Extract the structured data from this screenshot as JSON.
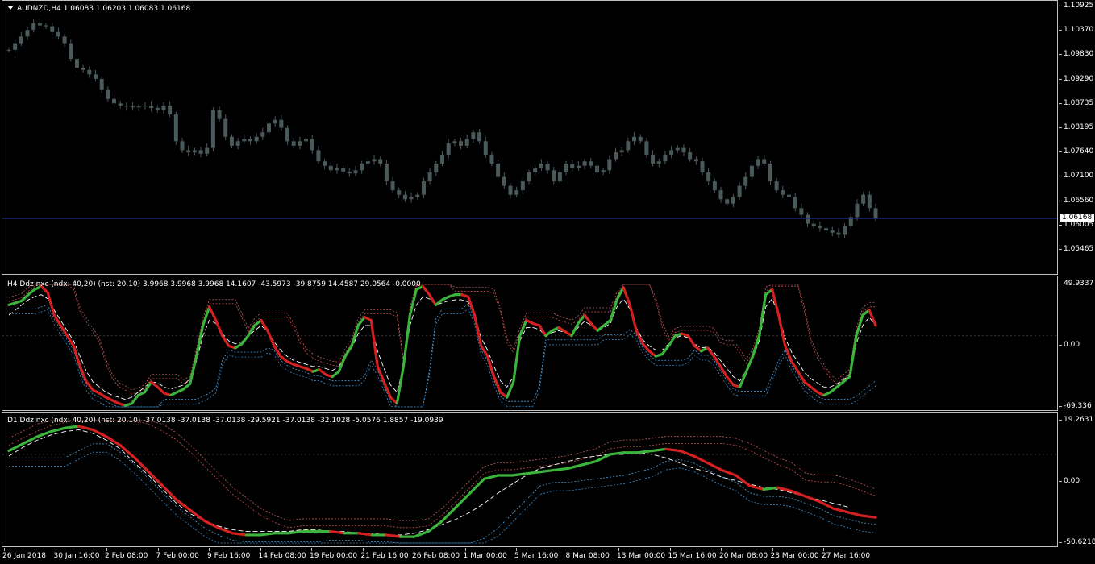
{
  "main": {
    "symbol": "AUDNZD,H4",
    "ohlc": "1.06083 1.06203 1.06083 1.06168",
    "title": "AUDNZD,H4  1.06083 1.06203 1.06083 1.06168",
    "price_levels": [
      "1.10925",
      "1.10370",
      "1.09830",
      "1.09290",
      "1.08735",
      "1.08195",
      "1.07640",
      "1.07100",
      "1.06560",
      "1.06005",
      "1.05465"
    ],
    "current_price": "1.06168",
    "colors": {
      "candles": "#4a5a5a",
      "price_line": "#1e2a9a",
      "background": "#000000"
    }
  },
  "h4": {
    "title": "H4 Ddz nxc (ndx: 40,20) (nst: 20,10) 3.9968 3.9968 3.9968 14.1607 -43.5973 -39.8759 14.4587 29.0564 -0.0000",
    "levels": [
      "49.9337",
      "0.00",
      "-69.336"
    ]
  },
  "d1": {
    "title": "D1 Ddz nxc (ndx: 40,20) (nst: 20,10) -37.0138 -37.0138 -37.0138 -29.5921 -37.0138 -32.1028 -5.0576 1.8857 -19.0939",
    "levels": [
      "19.2631",
      "0.00",
      "-50.6218"
    ]
  },
  "xaxis": [
    "26 Jan 2018",
    "30 Jan 16:00",
    "2 Feb 08:00",
    "7 Feb 00:00",
    "9 Feb 16:00",
    "14 Feb 08:00",
    "19 Feb 00:00",
    "21 Feb 16:00",
    "26 Feb 08:00",
    "1 Mar 00:00",
    "5 Mar 16:00",
    "8 Mar 08:00",
    "13 Mar 00:00",
    "15 Mar 16:00",
    "20 Mar 08:00",
    "23 Mar 00:00",
    "27 Mar 16:00"
  ],
  "chart_data": [
    {
      "type": "candlestick",
      "title": "AUDNZD,H4",
      "ylim": [
        1.05465,
        1.10925
      ],
      "close_approx": [
        1.0995,
        1.101,
        1.1025,
        1.104,
        1.1055,
        1.105,
        1.1048,
        1.1035,
        1.1025,
        1.101,
        1.0975,
        1.0955,
        1.095,
        1.094,
        1.093,
        1.0905,
        1.0885,
        1.0875,
        1.087,
        1.0868,
        1.0866,
        1.0868,
        1.087,
        1.0865,
        1.086,
        1.087,
        1.085,
        1.079,
        1.077,
        1.0765,
        1.077,
        1.0762,
        1.0775,
        1.086,
        1.084,
        1.08,
        1.078,
        1.079,
        1.0795,
        1.079,
        1.08,
        1.081,
        1.083,
        1.0838,
        1.082,
        1.079,
        1.078,
        1.079,
        1.0795,
        1.077,
        1.0745,
        1.0735,
        1.0725,
        1.073,
        1.0722,
        1.0718,
        1.0725,
        1.074,
        1.0745,
        1.075,
        1.074,
        1.07,
        1.068,
        1.067,
        1.066,
        1.0665,
        1.067,
        1.07,
        1.072,
        1.074,
        1.076,
        1.0785,
        1.079,
        1.078,
        1.0795,
        1.081,
        1.079,
        1.076,
        1.074,
        1.071,
        1.069,
        1.067,
        1.068,
        1.07,
        1.072,
        1.073,
        1.074,
        1.0725,
        1.07,
        1.072,
        1.074,
        1.073,
        1.0735,
        1.0745,
        1.0735,
        1.072,
        1.0725,
        1.075,
        1.0765,
        1.077,
        1.079,
        1.08,
        1.079,
        1.076,
        1.074,
        1.0745,
        1.076,
        1.077,
        1.0775,
        1.0765,
        1.075,
        1.0745,
        1.072,
        1.07,
        1.068,
        1.066,
        1.065,
        1.0665,
        1.069,
        1.071,
        1.0735,
        1.075,
        1.074,
        1.07,
        1.068,
        1.067,
        1.0665,
        1.064,
        1.0625,
        1.0605,
        1.06,
        1.0595,
        1.059,
        1.0585,
        1.058,
        1.06,
        1.062,
        1.065,
        1.067,
        1.064,
        1.0617
      ]
    },
    {
      "type": "line",
      "title": "H4 Ddz nxc",
      "ylim": [
        -69.336,
        49.9337
      ],
      "series": [
        {
          "values": [
            30,
            32,
            34,
            40,
            45,
            48,
            42,
            20,
            10,
            0,
            -10,
            -30,
            -45,
            -53,
            -56,
            -60,
            -63,
            -66,
            -68,
            -66,
            -58,
            -55,
            -45,
            -50,
            -56,
            -58,
            -55,
            -52,
            -47,
            -20,
            10,
            28,
            15,
            0,
            -10,
            -12,
            -8,
            0,
            10,
            15,
            5,
            -10,
            -20,
            -25,
            -28,
            -30,
            -32,
            -35,
            -33,
            -38,
            -40,
            -35,
            -20,
            -10,
            10,
            18,
            15,
            -30,
            -45,
            -60,
            -66,
            -30,
            20,
            45,
            48,
            40,
            30,
            35,
            38,
            40,
            40,
            38,
            20,
            -10,
            -20,
            -40,
            -55,
            -60,
            -45,
            0,
            15,
            12,
            10,
            0,
            5,
            8,
            4,
            0,
            12,
            20,
            12,
            5,
            10,
            15,
            35,
            47,
            30,
            5,
            -8,
            -15,
            -20,
            -18,
            -10,
            0,
            2,
            0,
            -10,
            -15,
            -12,
            -20,
            -30,
            -40,
            -48,
            -50,
            -35,
            -20,
            0,
            40,
            45,
            20,
            -10,
            -25,
            -35,
            -45,
            -50,
            -55,
            -58,
            -55,
            -50,
            -45,
            -40,
            0,
            20,
            25,
            10
          ]
        },
        {
          "values": [
            20,
            25,
            30,
            35,
            38,
            40,
            36,
            25,
            15,
            5,
            -5,
            -20,
            -35,
            -45,
            -50,
            -55,
            -58,
            -60,
            -62,
            -60,
            -55,
            -50,
            -45,
            -46,
            -50,
            -52,
            -50,
            -48,
            -42,
            -25,
            0,
            15,
            12,
            2,
            -5,
            -8,
            -6,
            0,
            5,
            10,
            4,
            -6,
            -14,
            -20,
            -24,
            -26,
            -28,
            -30,
            -30,
            -32,
            -34,
            -30,
            -20,
            -12,
            2,
            10,
            10,
            -15,
            -32,
            -48,
            -55,
            -30,
            10,
            30,
            38,
            36,
            30,
            32,
            34,
            35,
            35,
            33,
            20,
            -2,
            -14,
            -30,
            -44,
            -50,
            -40,
            -5,
            8,
            8,
            6,
            0,
            3,
            5,
            3,
            0,
            8,
            14,
            10,
            5,
            8,
            12,
            28,
            36,
            26,
            8,
            -4,
            -10,
            -14,
            -14,
            -8,
            -2,
            0,
            -2,
            -8,
            -12,
            -11,
            -16,
            -24,
            -32,
            -40,
            -44,
            -34,
            -22,
            -5,
            28,
            36,
            20,
            -2,
            -16,
            -26,
            -36,
            -42,
            -46,
            -50,
            -50,
            -47,
            -43,
            -38,
            -8,
            10,
            18,
            10
          ]
        }
      ]
    },
    {
      "type": "line",
      "title": "D1 Ddz nxc",
      "ylim": [
        -50.6218,
        19.2631
      ],
      "series": [
        {
          "values": [
            2,
            6,
            10,
            13,
            15,
            16,
            14,
            10,
            5,
            -2,
            -10,
            -18,
            -26,
            -32,
            -38,
            -42,
            -45,
            -46,
            -46,
            -45,
            -45,
            -44,
            -44,
            -44,
            -45,
            -45,
            -46,
            -46,
            -47,
            -47,
            -44,
            -38,
            -30,
            -22,
            -14,
            -12,
            -12,
            -11,
            -10,
            -9,
            -8,
            -6,
            -4,
            0,
            1,
            1,
            2,
            3,
            2,
            -1,
            -5,
            -9,
            -12,
            -18,
            -20,
            -19,
            -21,
            -24,
            -27,
            -31,
            -33,
            -35,
            -36
          ]
        },
        {
          "values": [
            -1,
            4,
            8,
            11,
            13,
            14,
            12,
            8,
            3,
            -5,
            -12,
            -20,
            -28,
            -34,
            -38,
            -41,
            -43,
            -44,
            -44,
            -44,
            -44,
            -43,
            -43,
            -44,
            -44,
            -45,
            -45,
            -46,
            -46,
            -45,
            -43,
            -40,
            -37,
            -33,
            -28,
            -22,
            -17,
            -12,
            -8,
            -6,
            -4,
            -2,
            -1,
            0,
            0,
            1,
            0,
            -2,
            -5,
            -8,
            -10,
            -13,
            -15,
            -17,
            -19,
            -20,
            -22,
            -24,
            -26,
            -28,
            -30
          ]
        }
      ]
    }
  ]
}
